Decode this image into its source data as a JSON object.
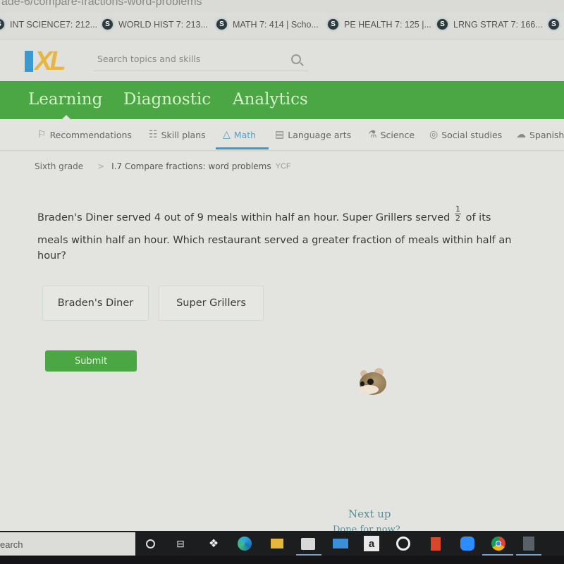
{
  "browser": {
    "url_fragment": "ade-6/compare-fractions-word-problems",
    "bookmarks": [
      {
        "label": "INT SCIENCE7: 212...",
        "icon": "schoology-icon"
      },
      {
        "label": "WORLD HIST 7: 213...",
        "icon": "schoology-icon"
      },
      {
        "label": "MATH 7: 414 | Scho...",
        "icon": "schoology-icon"
      },
      {
        "label": "PE HEALTH 7: 125 |...",
        "icon": "schoology-icon"
      },
      {
        "label": "LRNG STRAT 7: 166...",
        "icon": "schoology-icon"
      },
      {
        "label": "",
        "icon": "schoology-icon"
      }
    ]
  },
  "header": {
    "logo": "IXL",
    "search_placeholder": "Search topics and skills"
  },
  "main_nav": [
    {
      "label": "Learning",
      "active": true
    },
    {
      "label": "Diagnostic",
      "active": false
    },
    {
      "label": "Analytics",
      "active": false
    }
  ],
  "sub_nav": [
    {
      "label": "Recommendations",
      "icon": "signpost-icon",
      "active": false
    },
    {
      "label": "Skill plans",
      "icon": "checklist-icon",
      "active": false
    },
    {
      "label": "Math",
      "icon": "pyramid-icon",
      "active": true
    },
    {
      "label": "Language arts",
      "icon": "book-icon",
      "active": false
    },
    {
      "label": "Science",
      "icon": "flask-icon",
      "active": false
    },
    {
      "label": "Social studies",
      "icon": "globe-icon",
      "active": false
    },
    {
      "label": "Spanish",
      "icon": "speech-bubbles-icon",
      "active": false
    }
  ],
  "breadcrumb": {
    "grade": "Sixth grade",
    "separator": ">",
    "skill": "I.7 Compare fractions: word problems",
    "code": "YCF"
  },
  "question": {
    "part1": "Braden's Diner served 4 out of 9 meals within half an hour. Super Grillers served",
    "fraction": {
      "numerator": "1",
      "denominator": "2"
    },
    "part2": "of its meals within half an hour. Which restaurant served a greater fraction of meals within half an hour?",
    "line2": "meals within half an hour. Which restaurant served a greater fraction of meals within half an",
    "line3": "hour?"
  },
  "answers": [
    {
      "label": "Braden's Diner"
    },
    {
      "label": "Super Grillers"
    }
  ],
  "submit_label": "Submit",
  "next_up": {
    "title": "Next up",
    "subtitle": "Done for now?"
  },
  "taskbar": {
    "search_text": "earch",
    "icons": [
      "cortana-icon",
      "task-view-icon",
      "dropbox-icon",
      "edge-icon",
      "file-explorer-icon",
      "store-icon",
      "mail-icon",
      "amazon-icon",
      "app-icon",
      "office-icon",
      "zoom-icon",
      "chrome-icon",
      "calculator-icon"
    ]
  }
}
